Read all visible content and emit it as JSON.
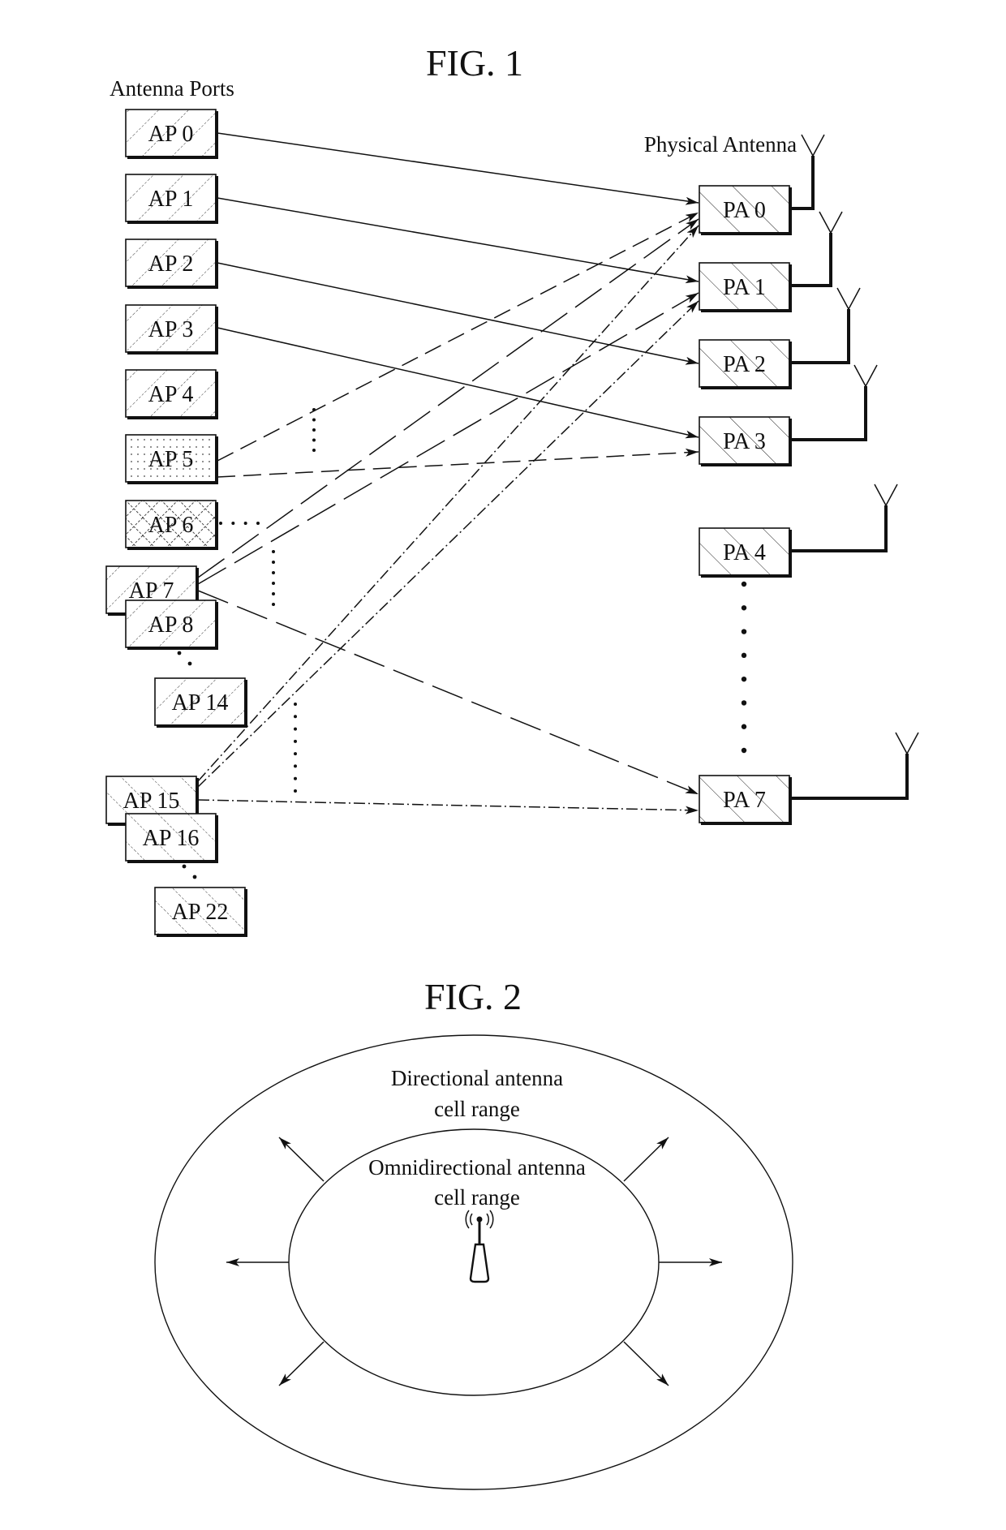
{
  "figure1": {
    "title": "FIG. 1",
    "left_heading": "Antenna Ports",
    "right_heading": "Physical Antenna",
    "antenna_ports": [
      {
        "id": "AP0",
        "label": "AP 0",
        "pattern": "hatch-forward"
      },
      {
        "id": "AP1",
        "label": "AP 1",
        "pattern": "hatch-forward"
      },
      {
        "id": "AP2",
        "label": "AP 2",
        "pattern": "hatch-forward"
      },
      {
        "id": "AP3",
        "label": "AP 3",
        "pattern": "hatch-forward"
      },
      {
        "id": "AP4",
        "label": "AP 4",
        "pattern": "hatch-forward"
      },
      {
        "id": "AP5",
        "label": "AP 5",
        "pattern": "dotted"
      },
      {
        "id": "AP6",
        "label": "AP 6",
        "pattern": "crosshatch"
      },
      {
        "id": "AP7",
        "label": "AP 7",
        "pattern": "hatch-forward"
      },
      {
        "id": "AP8",
        "label": "AP 8",
        "pattern": "hatch-forward"
      },
      {
        "id": "AP14",
        "label": "AP 14",
        "pattern": "hatch-forward"
      },
      {
        "id": "AP15",
        "label": "AP 15",
        "pattern": "hatch-back"
      },
      {
        "id": "AP16",
        "label": "AP 16",
        "pattern": "hatch-back"
      },
      {
        "id": "AP22",
        "label": "AP 22",
        "pattern": "hatch-back"
      }
    ],
    "physical_antennas": [
      {
        "id": "PA0",
        "label": "PA 0"
      },
      {
        "id": "PA1",
        "label": "PA 1"
      },
      {
        "id": "PA2",
        "label": "PA 2"
      },
      {
        "id": "PA3",
        "label": "PA 3"
      },
      {
        "id": "PA4",
        "label": "PA 4"
      },
      {
        "id": "PA7",
        "label": "PA 7"
      }
    ],
    "mappings": [
      {
        "from": "AP0",
        "to": "PA0",
        "style": "solid"
      },
      {
        "from": "AP1",
        "to": "PA1",
        "style": "solid"
      },
      {
        "from": "AP2",
        "to": "PA2",
        "style": "solid"
      },
      {
        "from": "AP3",
        "to": "PA3",
        "style": "solid"
      },
      {
        "from": "AP5",
        "to": "PA0",
        "style": "dashed"
      },
      {
        "from": "AP5",
        "to": "PA3",
        "style": "dashed"
      },
      {
        "from": "AP7",
        "to": "PA0",
        "style": "long-dash"
      },
      {
        "from": "AP7",
        "to": "PA1",
        "style": "long-dash"
      },
      {
        "from": "AP7",
        "to": "PA7",
        "style": "long-dash"
      },
      {
        "from": "AP15",
        "to": "PA0",
        "style": "dash-dot"
      },
      {
        "from": "AP15",
        "to": "PA1",
        "style": "dash-dot"
      },
      {
        "from": "AP15",
        "to": "PA7",
        "style": "dash-dot"
      }
    ]
  },
  "figure2": {
    "title": "FIG. 2",
    "outer_label_line1": "Directional antenna",
    "outer_label_line2": "cell range",
    "inner_label_line1": "Omnidirectional antenna",
    "inner_label_line2": "cell range",
    "center_icon": "antenna-tower-icon"
  }
}
